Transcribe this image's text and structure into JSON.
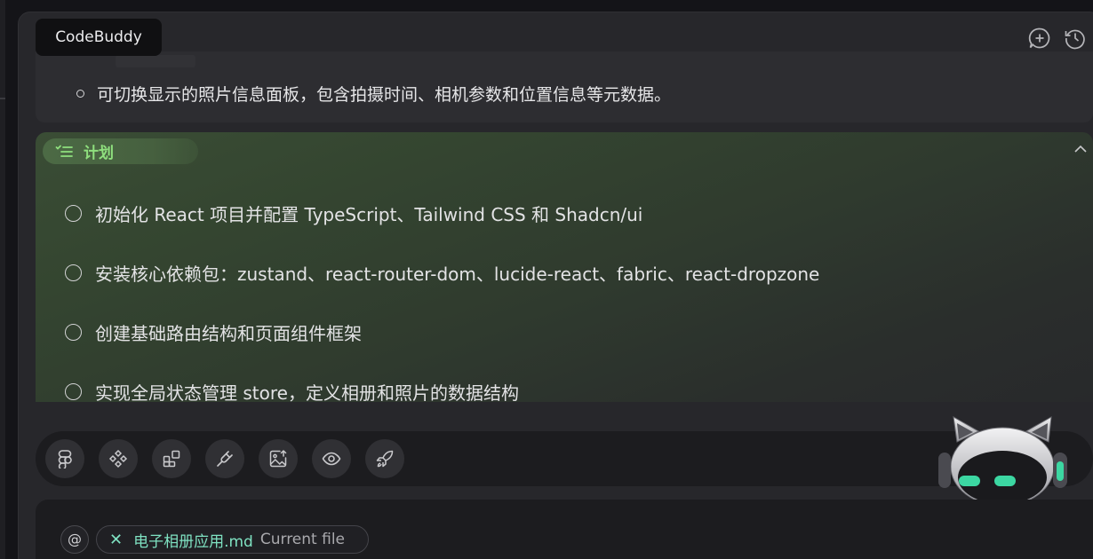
{
  "app": {
    "tooltip": "CodeBuddy"
  },
  "header": {
    "icons": [
      {
        "name": "new-chat-icon"
      },
      {
        "name": "history-icon"
      }
    ]
  },
  "summary": {
    "item": "可切换显示的照片信息面板，包含拍摄时间、相机参数和位置信息等元数据。"
  },
  "plan": {
    "label": "计划",
    "tasks": [
      "初始化 React 项目并配置 TypeScript、Tailwind CSS 和 Shadcn/ui",
      "安装核心依赖包：zustand、react-router-dom、lucide-react、fabric、react-dropzone",
      "创建基础路由结构和页面组件框架",
      "实现全局状态管理 store，定义相册和照片的数据结构"
    ]
  },
  "toolbar": {
    "buttons": [
      {
        "name": "figma-icon"
      },
      {
        "name": "components-icon"
      },
      {
        "name": "blocks-icon"
      },
      {
        "name": "plug-icon"
      },
      {
        "name": "image-upload-icon"
      },
      {
        "name": "preview-eye-icon"
      },
      {
        "name": "rocket-deploy-icon"
      }
    ]
  },
  "input": {
    "at_symbol": "@",
    "file_chip": {
      "name": "电子相册应用.md",
      "meta": "Current file"
    }
  },
  "colors": {
    "accent_green": "#8fe07e",
    "file_teal": "#7fe2c2",
    "panel_bg": "#27272b"
  }
}
